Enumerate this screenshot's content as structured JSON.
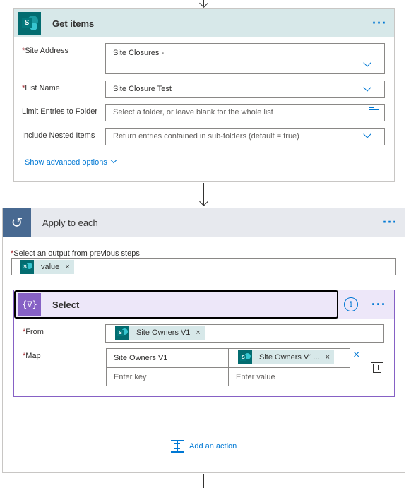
{
  "get_items": {
    "title": "Get items",
    "more": "···",
    "icon": "sharepoint-icon",
    "fields": {
      "site_address": {
        "label": "Site Address",
        "value": "Site Closures -"
      },
      "list_name": {
        "label": "List Name",
        "value": "Site Closure Test"
      },
      "limit_folder": {
        "label": "Limit Entries to Folder",
        "placeholder": "Select a folder, or leave blank for the whole list"
      },
      "nested_items": {
        "label": "Include Nested Items",
        "value": "Return entries contained in sub-folders (default = true)"
      }
    },
    "advanced_link": "Show advanced options"
  },
  "apply_each": {
    "title": "Apply to each",
    "more": "···",
    "icon": "loop-icon",
    "output_label": "Select an output from previous steps",
    "token": "value",
    "token_remove": "×"
  },
  "select": {
    "title": "Select",
    "icon_glyph": "{∇}",
    "info": "i",
    "more": "···",
    "from_label": "From",
    "from_token": "Site Owners V1",
    "token_remove": "×",
    "map_label": "Map",
    "map_rows": [
      {
        "key": "Site Owners V1",
        "value_token": "Site Owners V1..."
      },
      {
        "key_placeholder": "Enter key",
        "value_placeholder": "Enter value"
      }
    ],
    "delete_row": "×"
  },
  "add_action": "Add an action",
  "required_marker": "*",
  "colors": {
    "accent": "#0078d4",
    "sharepoint": "#036c70",
    "sharepoint_header": "#d7e8e9",
    "loop": "#486991",
    "select": "#8661c5",
    "required": "#a4262c"
  }
}
